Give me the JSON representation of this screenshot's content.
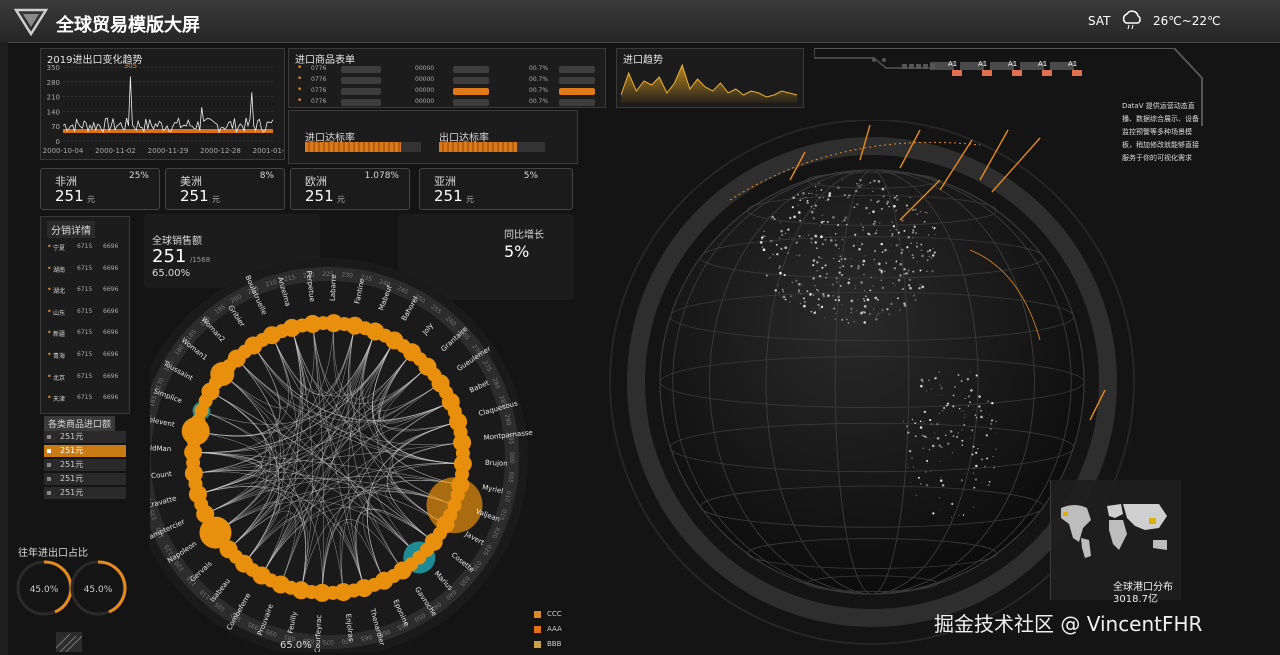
{
  "header": {
    "title": "全球贸易模版大屏",
    "weekday": "SAT",
    "temperature": "26℃~22℃",
    "logo_icon": "triangle-logo-icon",
    "weather_icon": "cloud-rain-icon"
  },
  "trend_panel": {
    "title": "2019进出口变化趋势",
    "peak_label": "305",
    "y_ticks": [
      "350",
      "280",
      "210",
      "140",
      "70",
      "0"
    ],
    "x_ticks": [
      "2000-10-04",
      "2000-11-02",
      "2000-11-29",
      "2000-12-28",
      "2001-01-25"
    ]
  },
  "goods_table": {
    "title": "进口商品表单",
    "rows": [
      {
        "c1": "0776",
        "c2": "00000",
        "pct": "00.7%"
      },
      {
        "c1": "0776",
        "c2": "00000",
        "pct": "00.7%"
      },
      {
        "c1": "0776",
        "c2": "00000",
        "pct": "00.7%"
      },
      {
        "c1": "0776",
        "c2": "00000",
        "pct": "00.7%"
      }
    ]
  },
  "import_trend": {
    "title": "进口趋势"
  },
  "rates": {
    "import_label": "进口达标率",
    "export_label": "出口达标率"
  },
  "regions": [
    {
      "name": "非洲",
      "pct": "25%",
      "value": "251",
      "unit": "元"
    },
    {
      "name": "美洲",
      "pct": "8%",
      "value": "251",
      "unit": "元"
    },
    {
      "name": "欧洲",
      "pct": "1.078%",
      "value": "251",
      "unit": "元"
    },
    {
      "name": "亚洲",
      "pct": "5%",
      "value": "251",
      "unit": "元"
    }
  ],
  "distribution": {
    "title": "分销详情",
    "rows": [
      {
        "name": "宁夏",
        "a": "6715",
        "b": "6696"
      },
      {
        "name": "湖南",
        "a": "6715",
        "b": "6696"
      },
      {
        "name": "湖北",
        "a": "6715",
        "b": "6696"
      },
      {
        "name": "山东",
        "a": "6715",
        "b": "6696"
      },
      {
        "name": "新疆",
        "a": "6715",
        "b": "6696"
      },
      {
        "name": "青海",
        "a": "6715",
        "b": "6696"
      },
      {
        "name": "北京",
        "a": "6715",
        "b": "6696"
      },
      {
        "name": "天津",
        "a": "6715",
        "b": "6696"
      }
    ]
  },
  "category_import": {
    "title": "各类商品进口额",
    "items": [
      "251元",
      "251元",
      "251元",
      "251元",
      "251元"
    ]
  },
  "sales": {
    "title": "全球销售额",
    "value": "251",
    "suffix": "/1568",
    "percent": "65.00%",
    "yoy_label": "同比增长",
    "yoy_value": "5%",
    "bottom_percent": "65.0%"
  },
  "chord_names": [
    "Fantine",
    "Mabeuf",
    "Bahorel",
    "Joly",
    "Grantaire",
    "Gueulemer",
    "Babet",
    "Claquesous",
    "Montparnasse",
    "Brujon",
    "Myriel",
    "Valjean",
    "Javert",
    "Cosette",
    "Marius",
    "Gavroche",
    "Eponine",
    "Thenardier",
    "Enjolras",
    "Courfeyrac",
    "Feuilly",
    "Prouvaire",
    "Combeferre",
    "Isabeau",
    "Gervais",
    "Napoleon",
    "Champtercier",
    "Cravatte",
    "Count",
    "OldMan",
    "Fauchelevent",
    "Simplice",
    "Toussaint",
    "Woman1",
    "Woman2",
    "Gribier",
    "Boulatruelle",
    "Anzelma",
    "Perpetue",
    "Labarre"
  ],
  "chord_legend": [
    {
      "label": "CCC",
      "color": "#d98b2a"
    },
    {
      "label": "AAA",
      "color": "#e0701a"
    },
    {
      "label": "BBB",
      "color": "#c9a04a"
    }
  ],
  "export_ratio": {
    "title": "往年进出口占比",
    "left": "45.0%",
    "right": "45.0%"
  },
  "globe": {
    "tab_labels": [
      "A1",
      "A1",
      "A1",
      "A1",
      "A1"
    ],
    "description": "DataV 提供运营动态直播、数据综合展示、设备监控预警等多种场景模板，稍加修改就能够直接服务于你的可视化需求"
  },
  "port_map": {
    "title": "全球港口分布",
    "value": "3018.7亿"
  },
  "watermark": "掘金技术社区 @ VincentFHR",
  "colors": {
    "accent": "#e88a1c",
    "panel": "#1c1c1c",
    "teal": "#1f8c95"
  }
}
